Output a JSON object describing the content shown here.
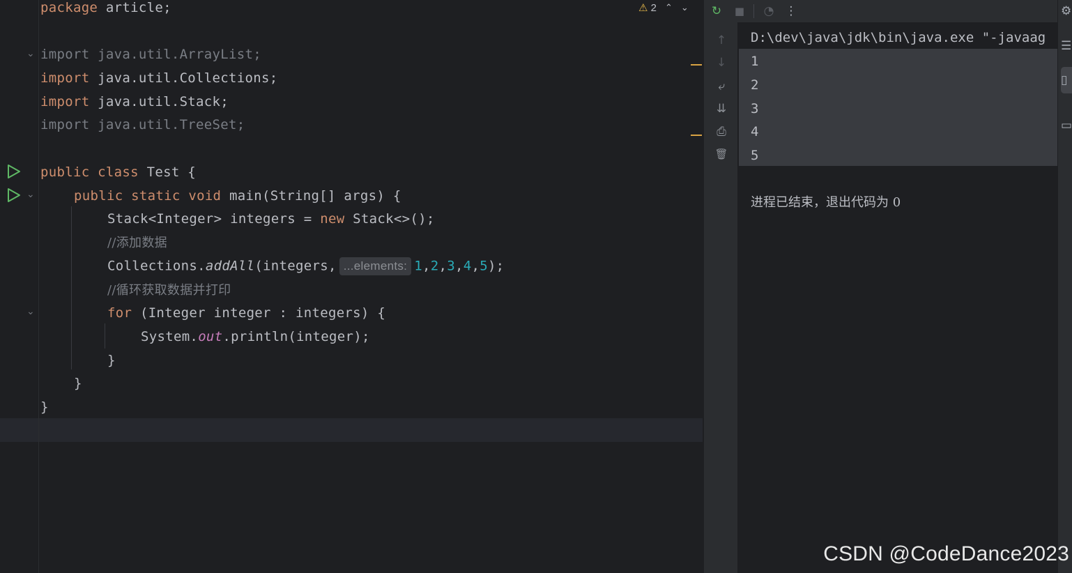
{
  "editor": {
    "code": {
      "l1_kw": "package",
      "l1_rest": " article;",
      "l2_kw": "import",
      "l2_rest": " java.util.ArrayList;",
      "l3_kw": "import",
      "l3_rest": " java.util.Collections;",
      "l4_kw": "import",
      "l4_rest": " java.util.Stack;",
      "l5_kw": "import",
      "l5_rest": " java.util.TreeSet;",
      "l6_kw": "public class",
      "l6_rest": " Test {",
      "l7_kw": "public static void",
      "l7_rest": " main(String[] args) {",
      "l8_a": "Stack<Integer> integers = ",
      "l8_kw": "new",
      "l8_b": " Stack<>();",
      "l9_comment": "//添加数据",
      "l10_a": "Collections.",
      "l10_method": "addAll",
      "l10_b": "(integers,",
      "l10_hint": "...elements:",
      "l10_n1": "1",
      "l10_n2": "2",
      "l10_n3": "3",
      "l10_n4": "4",
      "l10_n5": "5",
      "l10_comma": ",",
      "l10_end": ");",
      "l11_comment": "//循环获取数据并打印",
      "l12_kw": "for",
      "l12_rest": " (Integer integer : integers) {",
      "l13_a": "System.",
      "l13_field": "out",
      "l13_b": ".println(integer);",
      "l14": "}",
      "l15": "}",
      "l16": "}"
    },
    "inspections": {
      "warning_count": "2",
      "warning_icon": "⚠",
      "up_icon": "⌃",
      "down_icon": "⌄"
    }
  },
  "run": {
    "toolbar": {
      "rerun_icon": "↻",
      "stop_icon": "■",
      "profiler_icon": "◔",
      "more_icon": "⋮"
    },
    "side": {
      "up_icon": "↑",
      "down_icon": "↓",
      "wrap_icon": "⤶",
      "scroll_end_icon": "⇊",
      "print_icon": "⎙",
      "trash_icon": "🗑"
    },
    "console": {
      "command": "D:\\dev\\java\\jdk\\bin\\java.exe \"-javaag",
      "outputs": [
        "1",
        "2",
        "3",
        "4",
        "5"
      ],
      "exit_message": "进程已结束，退出代码为 0"
    }
  },
  "stripe": {
    "settings_icon": "⚙",
    "database_icon": "☰",
    "active_icon": "▯",
    "file_icon": "▭"
  },
  "watermark": "CSDN @CodeDance2023"
}
